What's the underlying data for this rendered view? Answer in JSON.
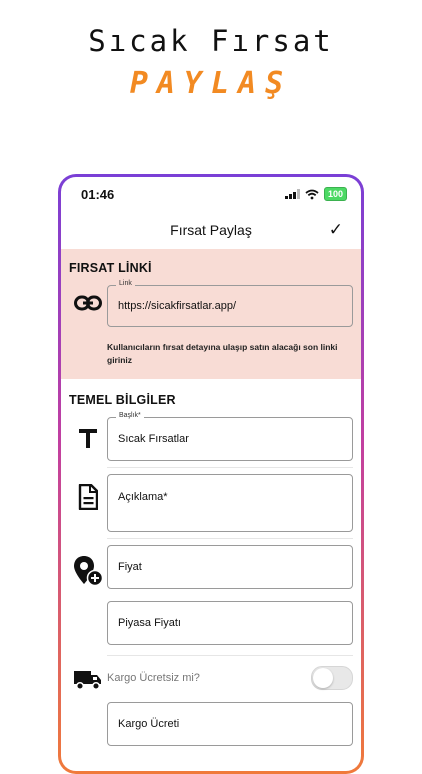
{
  "promo": {
    "title": "Sıcak Fırsat",
    "subtitle": "PAYLAŞ"
  },
  "status_bar": {
    "time": "01:46",
    "battery": "100"
  },
  "nav": {
    "title": "Fırsat Paylaş",
    "confirm_icon": "check-icon"
  },
  "link_section": {
    "title": "FIRSAT LİNKİ",
    "field_label": "Link",
    "field_value": "https://sicakfirsatlar.app/",
    "hint": "Kullanıcıların fırsat detayına ulaşıp satın alacağı son linki giriniz",
    "icon": "link-icon"
  },
  "basic_section": {
    "title": "TEMEL BİLGİLER",
    "title_field": {
      "label": "Başlık*",
      "value": "Sıcak Fırsatlar",
      "icon": "text-icon"
    },
    "description_field": {
      "placeholder": "Açıklama*",
      "icon": "document-icon"
    },
    "price_field": {
      "placeholder": "Fiyat",
      "icon": "location-add-icon"
    },
    "market_price_field": {
      "placeholder": "Piyasa Fiyatı"
    },
    "shipping": {
      "label": "Kargo Ücretsiz mi?",
      "icon": "truck-icon",
      "enabled": false
    },
    "shipping_fee_field": {
      "placeholder": "Kargo Ücreti"
    }
  },
  "colors": {
    "accent_orange": "#f28a22",
    "link_section_bg": "#f8dcd5",
    "frame_top": "#7a3fd6",
    "frame_bottom": "#f07a3a"
  }
}
